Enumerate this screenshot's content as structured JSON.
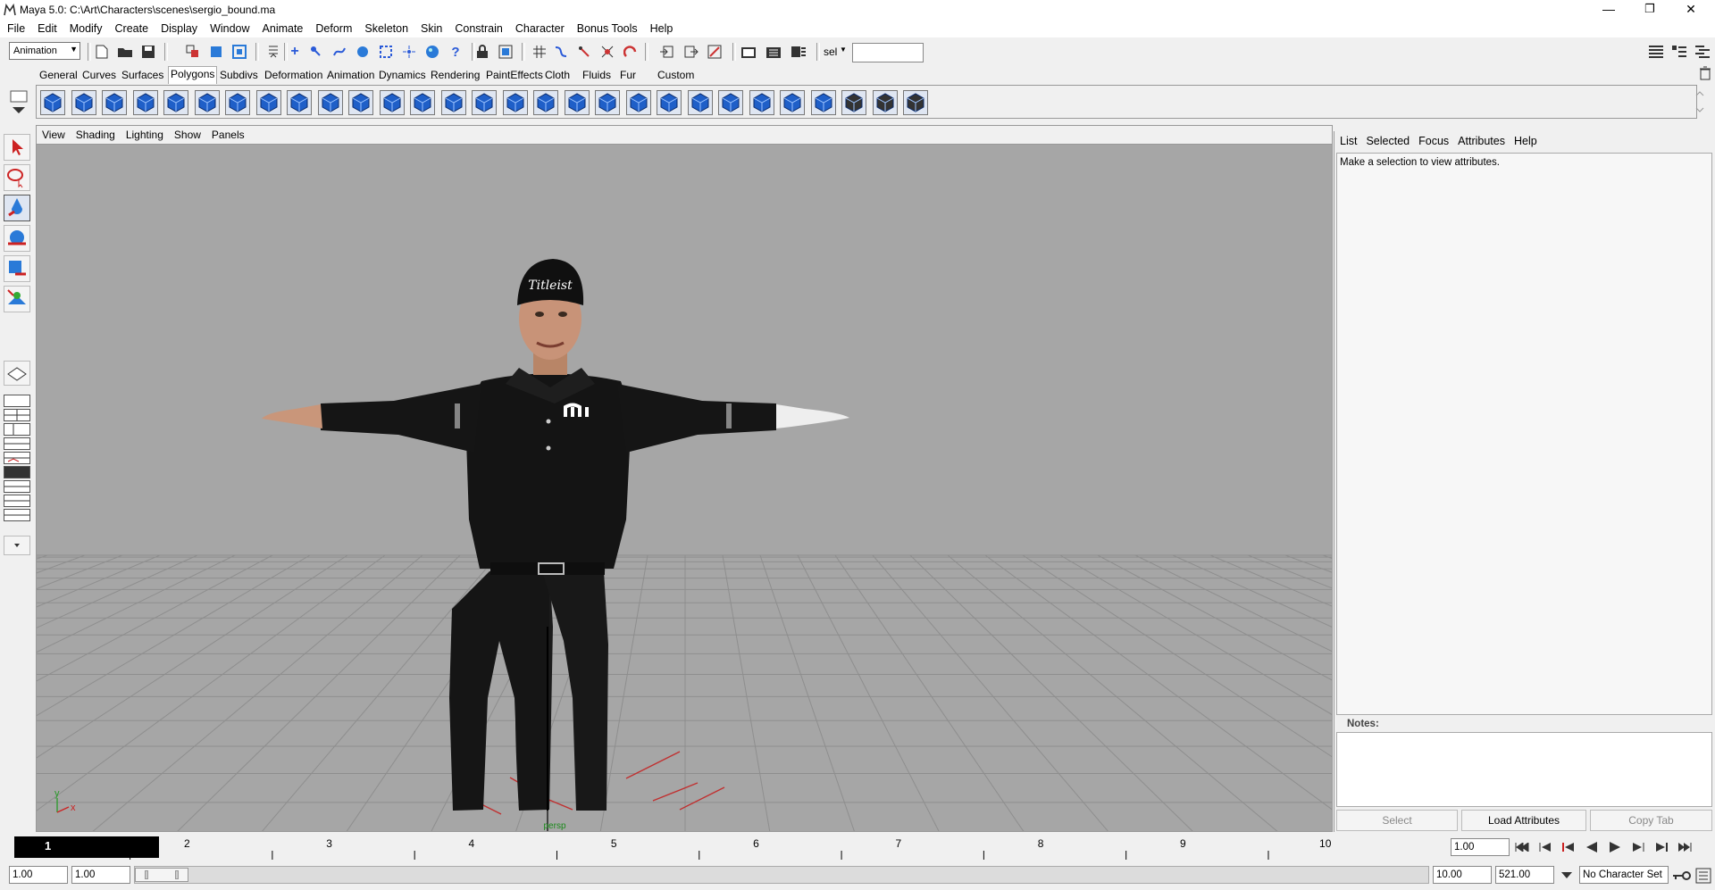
{
  "window": {
    "title": "Maya 5.0: C:\\Art\\Characters\\scenes\\sergio_bound.ma",
    "min": "—",
    "restore": "❐",
    "close": "✕"
  },
  "menubar": [
    "File",
    "Edit",
    "Modify",
    "Create",
    "Display",
    "Window",
    "Animate",
    "Deform",
    "Skeleton",
    "Skin",
    "Constrain",
    "Character",
    "Bonus Tools",
    "Help"
  ],
  "statusline": {
    "menuset": "Animation",
    "sel_label": "sel",
    "input_value": ""
  },
  "shelf_tabs": [
    {
      "label": "General"
    },
    {
      "label": "Curves"
    },
    {
      "label": "Surfaces"
    },
    {
      "label": "Polygons",
      "active": true
    },
    {
      "label": "Subdivs"
    },
    {
      "label": "Deformation"
    },
    {
      "label": "Animation"
    },
    {
      "label": "Dynamics"
    },
    {
      "label": "Rendering"
    },
    {
      "label": "PaintEffects"
    },
    {
      "label": "Cloth"
    },
    {
      "label": "Fluids"
    },
    {
      "label": "Fur"
    },
    {
      "label": "Custom"
    }
  ],
  "viewport": {
    "menu": [
      "View",
      "Shading",
      "Lighting",
      "Show",
      "Panels"
    ],
    "camera_label": "persp",
    "axis_y": "y",
    "axis_x": "x",
    "cap_logo": "Titleist"
  },
  "attribute_editor": {
    "menu": [
      "List",
      "Selected",
      "Focus",
      "Attributes",
      "Help"
    ],
    "message": "Make a selection to view attributes.",
    "notes_label": "Notes:",
    "notes_value": "",
    "buttons": {
      "select": "Select",
      "load": "Load Attributes",
      "copy": "Copy Tab"
    }
  },
  "timeline": {
    "ticks": [
      "1",
      "2",
      "3",
      "4",
      "5",
      "6",
      "7",
      "8",
      "9",
      "10"
    ],
    "current_frame": "1",
    "current_time": "1.00"
  },
  "range": {
    "start_time": "1.00",
    "playback_start": "1.00",
    "playback_end": "10.00",
    "end_time": "521.00",
    "character_set": "No Character Set"
  }
}
